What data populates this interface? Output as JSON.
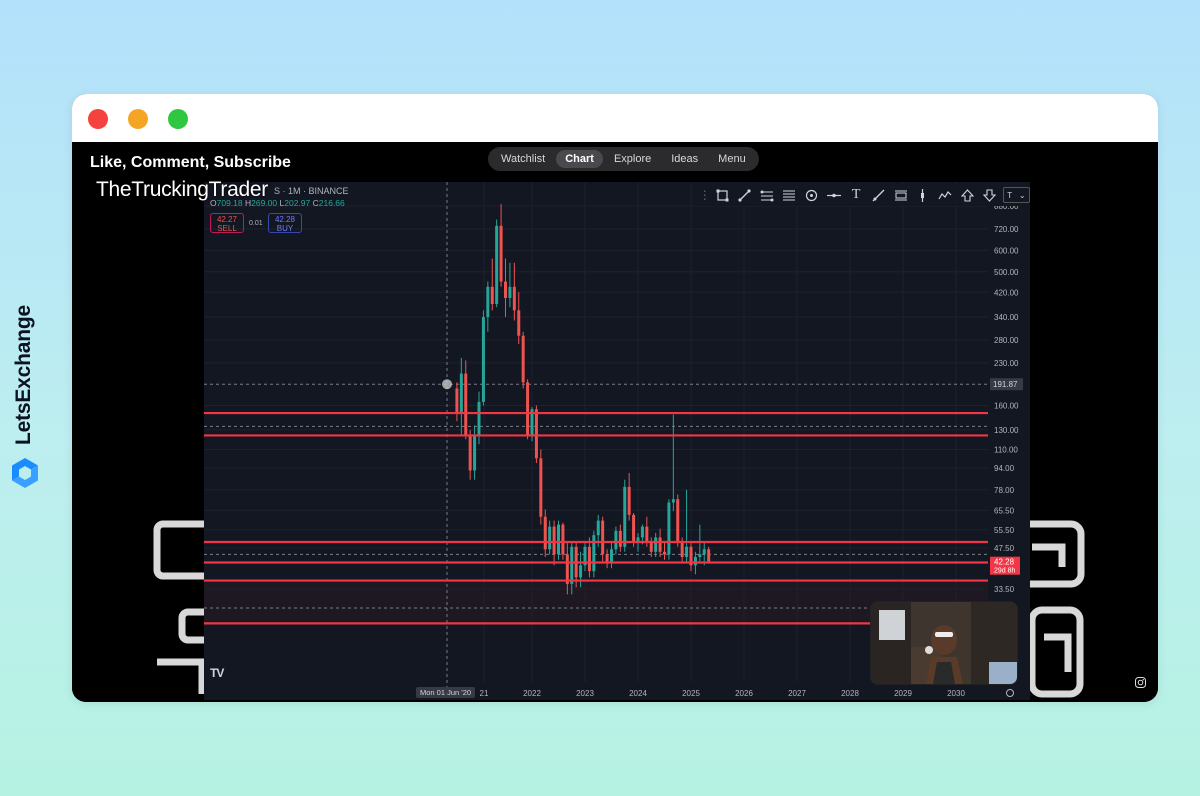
{
  "brand": {
    "name": "LetsExchange",
    "logo_icon": "letsexchange-logo-icon",
    "color": "#0b1220",
    "accent": "#1a8cff"
  },
  "window": {
    "controls": [
      "close",
      "minimize",
      "maximize"
    ]
  },
  "video": {
    "caption": "Like, Comment, Subscribe",
    "channel": "TheTruckingTrader"
  },
  "nav": {
    "items": [
      {
        "label": "Watchlist",
        "active": false
      },
      {
        "label": "Chart",
        "active": true
      },
      {
        "label": "Explore",
        "active": false
      },
      {
        "label": "Ideas",
        "active": false
      },
      {
        "label": "Menu",
        "active": false
      }
    ]
  },
  "chart": {
    "symbol": "S · 1M · BINANCE",
    "ohlc": {
      "o_label": "O",
      "o": "709.18",
      "h_label": "H",
      "h": "269.00",
      "l_label": "L",
      "l": "202.97",
      "c_label": "C",
      "c": "216.66"
    },
    "sell": {
      "price": "42.27",
      "label": "SELL"
    },
    "buy": {
      "price": "42.28",
      "label": "BUY"
    },
    "spread": "0.01",
    "price_tag": {
      "value": "42.28",
      "countdown": "29d 8h"
    },
    "crosshair_tag": "191.87",
    "date_tag": "Mon 01 Jun '20",
    "tv_logo": "TV",
    "toolbar_text_tool": "T"
  },
  "chart_data": {
    "type": "candlestick",
    "y_scale": "log",
    "y_ticks": [
      "880.00",
      "720.00",
      "600.00",
      "500.00",
      "420.00",
      "340.00",
      "280.00",
      "230.00",
      "160.00",
      "130.00",
      "110.00",
      "94.00",
      "78.00",
      "65.50",
      "55.50",
      "47.50",
      "33.50"
    ],
    "x_ticks": [
      "21",
      "2022",
      "2023",
      "2024",
      "2025",
      "2026",
      "2027",
      "2028",
      "2029",
      "2030"
    ],
    "horizontal_levels": [
      150,
      124,
      50,
      42,
      36,
      25
    ],
    "dashed_levels": [
      191.87,
      134,
      45,
      28.5
    ],
    "colors": {
      "up": "#26a69a",
      "down": "#ef5350",
      "level": "#f23645",
      "background": "#131722"
    },
    "candles": [
      {
        "t": "2020-08",
        "o": 185,
        "h": 195,
        "l": 140,
        "c": 150
      },
      {
        "t": "2020-09",
        "o": 150,
        "h": 240,
        "l": 125,
        "c": 210
      },
      {
        "t": "2020-10",
        "o": 210,
        "h": 235,
        "l": 120,
        "c": 125
      },
      {
        "t": "2020-11",
        "o": 125,
        "h": 130,
        "l": 85,
        "c": 92
      },
      {
        "t": "2020-12",
        "o": 92,
        "h": 135,
        "l": 85,
        "c": 125
      },
      {
        "t": "2021-01",
        "o": 125,
        "h": 180,
        "l": 115,
        "c": 165
      },
      {
        "t": "2021-02",
        "o": 165,
        "h": 360,
        "l": 160,
        "c": 340
      },
      {
        "t": "2021-03",
        "o": 340,
        "h": 460,
        "l": 300,
        "c": 440
      },
      {
        "t": "2021-04",
        "o": 440,
        "h": 560,
        "l": 360,
        "c": 380
      },
      {
        "t": "2021-05",
        "o": 380,
        "h": 780,
        "l": 370,
        "c": 740
      },
      {
        "t": "2021-06",
        "o": 740,
        "h": 890,
        "l": 440,
        "c": 460
      },
      {
        "t": "2021-07",
        "o": 460,
        "h": 560,
        "l": 340,
        "c": 400
      },
      {
        "t": "2021-08",
        "o": 400,
        "h": 540,
        "l": 370,
        "c": 440
      },
      {
        "t": "2021-09",
        "o": 440,
        "h": 540,
        "l": 330,
        "c": 360
      },
      {
        "t": "2021-10",
        "o": 360,
        "h": 420,
        "l": 270,
        "c": 290
      },
      {
        "t": "2021-11",
        "o": 290,
        "h": 300,
        "l": 185,
        "c": 195
      },
      {
        "t": "2021-12",
        "o": 195,
        "h": 200,
        "l": 120,
        "c": 125
      },
      {
        "t": "2022-01",
        "o": 125,
        "h": 158,
        "l": 118,
        "c": 155
      },
      {
        "t": "2022-02",
        "o": 155,
        "h": 160,
        "l": 98,
        "c": 102
      },
      {
        "t": "2022-03",
        "o": 102,
        "h": 110,
        "l": 58,
        "c": 62
      },
      {
        "t": "2022-04",
        "o": 62,
        "h": 66,
        "l": 44,
        "c": 47
      },
      {
        "t": "2022-05",
        "o": 47,
        "h": 60,
        "l": 45,
        "c": 57
      },
      {
        "t": "2022-06",
        "o": 57,
        "h": 60,
        "l": 41,
        "c": 45
      },
      {
        "t": "2022-07",
        "o": 45,
        "h": 60,
        "l": 43,
        "c": 58
      },
      {
        "t": "2022-08",
        "o": 58,
        "h": 59,
        "l": 43,
        "c": 45
      },
      {
        "t": "2022-09",
        "o": 45,
        "h": 50,
        "l": 32,
        "c": 35
      },
      {
        "t": "2022-10",
        "o": 35,
        "h": 50,
        "l": 32,
        "c": 48
      },
      {
        "t": "2022-11",
        "o": 48,
        "h": 50,
        "l": 34,
        "c": 37
      },
      {
        "t": "2022-12",
        "o": 37,
        "h": 46,
        "l": 34,
        "c": 41
      },
      {
        "t": "2023-01",
        "o": 41,
        "h": 50,
        "l": 39,
        "c": 48
      },
      {
        "t": "2023-02",
        "o": 48,
        "h": 52,
        "l": 37,
        "c": 39
      },
      {
        "t": "2023-03",
        "o": 39,
        "h": 55,
        "l": 37,
        "c": 53
      },
      {
        "t": "2023-04",
        "o": 53,
        "h": 63,
        "l": 48,
        "c": 60
      },
      {
        "t": "2023-05",
        "o": 60,
        "h": 62,
        "l": 42,
        "c": 45
      },
      {
        "t": "2023-06",
        "o": 45,
        "h": 47,
        "l": 40,
        "c": 42
      },
      {
        "t": "2023-07",
        "o": 42,
        "h": 50,
        "l": 40,
        "c": 47
      },
      {
        "t": "2023-08",
        "o": 47,
        "h": 57,
        "l": 45,
        "c": 55
      },
      {
        "t": "2023-09",
        "o": 55,
        "h": 58,
        "l": 46,
        "c": 48
      },
      {
        "t": "2023-10",
        "o": 48,
        "h": 85,
        "l": 46,
        "c": 80
      },
      {
        "t": "2023-11",
        "o": 80,
        "h": 90,
        "l": 60,
        "c": 63
      },
      {
        "t": "2023-12",
        "o": 63,
        "h": 64,
        "l": 48,
        "c": 50
      },
      {
        "t": "2024-01",
        "o": 50,
        "h": 54,
        "l": 46,
        "c": 52
      },
      {
        "t": "2024-02",
        "o": 52,
        "h": 58,
        "l": 49,
        "c": 57
      },
      {
        "t": "2024-03",
        "o": 57,
        "h": 62,
        "l": 48,
        "c": 50
      },
      {
        "t": "2024-04",
        "o": 50,
        "h": 52,
        "l": 44,
        "c": 46
      },
      {
        "t": "2024-05",
        "o": 46,
        "h": 54,
        "l": 44,
        "c": 52
      },
      {
        "t": "2024-06",
        "o": 52,
        "h": 56,
        "l": 44,
        "c": 46
      },
      {
        "t": "2024-07",
        "o": 46,
        "h": 50,
        "l": 43,
        "c": 45
      },
      {
        "t": "2024-08",
        "o": 45,
        "h": 72,
        "l": 43,
        "c": 70
      },
      {
        "t": "2024-09",
        "o": 70,
        "h": 148,
        "l": 65,
        "c": 72
      },
      {
        "t": "2024-10",
        "o": 72,
        "h": 75,
        "l": 48,
        "c": 50
      },
      {
        "t": "2024-11",
        "o": 50,
        "h": 52,
        "l": 42,
        "c": 44
      },
      {
        "t": "2024-12",
        "o": 44,
        "h": 78,
        "l": 42,
        "c": 48
      },
      {
        "t": "2025-01",
        "o": 48,
        "h": 50,
        "l": 39,
        "c": 41
      },
      {
        "t": "2025-02",
        "o": 41,
        "h": 46,
        "l": 38,
        "c": 44
      },
      {
        "t": "2025-03",
        "o": 44,
        "h": 58,
        "l": 42,
        "c": 45
      },
      {
        "t": "2025-04",
        "o": 45,
        "h": 50,
        "l": 41,
        "c": 47
      },
      {
        "t": "2025-05",
        "o": 47,
        "h": 48,
        "l": 42,
        "c": 42.28
      }
    ]
  }
}
